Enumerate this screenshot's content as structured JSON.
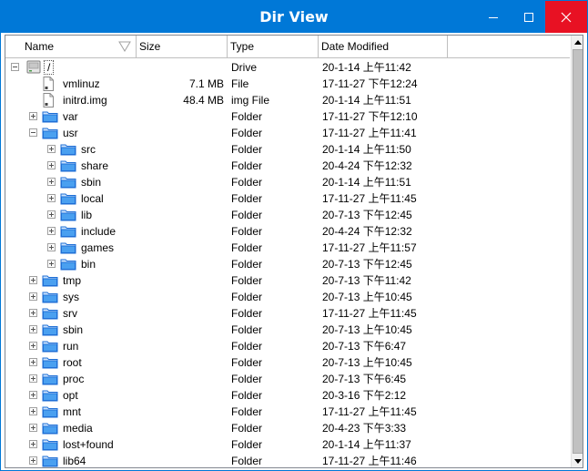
{
  "window": {
    "title": "Dir View"
  },
  "columns": {
    "name": "Name",
    "size": "Size",
    "type": "Type",
    "date": "Date Modified"
  },
  "rows": [
    {
      "name": "/",
      "size": "",
      "type": "Drive",
      "date": "20-1-14 上午11:42",
      "icon": "drive-icon",
      "expander": "minus",
      "depth": 0
    },
    {
      "name": "vmlinuz",
      "size": "7.1 MB",
      "type": "File",
      "date": "17-11-27 下午12:24",
      "icon": "file-icon",
      "expander": "",
      "depth": 1
    },
    {
      "name": "initrd.img",
      "size": "48.4 MB",
      "type": "img File",
      "date": "20-1-14 上午11:51",
      "icon": "file-icon",
      "expander": "",
      "depth": 1
    },
    {
      "name": "var",
      "size": "",
      "type": "Folder",
      "date": "17-11-27 下午12:10",
      "icon": "folder-icon",
      "expander": "plus",
      "depth": 1
    },
    {
      "name": "usr",
      "size": "",
      "type": "Folder",
      "date": "17-11-27 上午11:41",
      "icon": "folder-icon",
      "expander": "minus",
      "depth": 1
    },
    {
      "name": "src",
      "size": "",
      "type": "Folder",
      "date": "20-1-14 上午11:50",
      "icon": "folder-icon",
      "expander": "plus",
      "depth": 2
    },
    {
      "name": "share",
      "size": "",
      "type": "Folder",
      "date": "20-4-24 下午12:32",
      "icon": "folder-icon",
      "expander": "plus",
      "depth": 2
    },
    {
      "name": "sbin",
      "size": "",
      "type": "Folder",
      "date": "20-1-14 上午11:51",
      "icon": "folder-icon",
      "expander": "plus",
      "depth": 2
    },
    {
      "name": "local",
      "size": "",
      "type": "Folder",
      "date": "17-11-27 上午11:45",
      "icon": "folder-icon",
      "expander": "plus",
      "depth": 2
    },
    {
      "name": "lib",
      "size": "",
      "type": "Folder",
      "date": "20-7-13 下午12:45",
      "icon": "folder-icon",
      "expander": "plus",
      "depth": 2
    },
    {
      "name": "include",
      "size": "",
      "type": "Folder",
      "date": "20-4-24 下午12:32",
      "icon": "folder-icon",
      "expander": "plus",
      "depth": 2
    },
    {
      "name": "games",
      "size": "",
      "type": "Folder",
      "date": "17-11-27 上午11:57",
      "icon": "folder-icon",
      "expander": "plus",
      "depth": 2
    },
    {
      "name": "bin",
      "size": "",
      "type": "Folder",
      "date": "20-7-13 下午12:45",
      "icon": "folder-icon",
      "expander": "plus",
      "depth": 2
    },
    {
      "name": "tmp",
      "size": "",
      "type": "Folder",
      "date": "20-7-13 下午11:42",
      "icon": "folder-icon",
      "expander": "plus",
      "depth": 1
    },
    {
      "name": "sys",
      "size": "",
      "type": "Folder",
      "date": "20-7-13 上午10:45",
      "icon": "folder-icon",
      "expander": "plus",
      "depth": 1
    },
    {
      "name": "srv",
      "size": "",
      "type": "Folder",
      "date": "17-11-27 上午11:45",
      "icon": "folder-icon",
      "expander": "plus",
      "depth": 1
    },
    {
      "name": "sbin",
      "size": "",
      "type": "Folder",
      "date": "20-7-13 上午10:45",
      "icon": "folder-icon",
      "expander": "plus",
      "depth": 1
    },
    {
      "name": "run",
      "size": "",
      "type": "Folder",
      "date": "20-7-13 下午6:47",
      "icon": "folder-icon",
      "expander": "plus",
      "depth": 1
    },
    {
      "name": "root",
      "size": "",
      "type": "Folder",
      "date": "20-7-13 上午10:45",
      "icon": "folder-icon",
      "expander": "plus",
      "depth": 1
    },
    {
      "name": "proc",
      "size": "",
      "type": "Folder",
      "date": "20-7-13 下午6:45",
      "icon": "folder-icon",
      "expander": "plus",
      "depth": 1
    },
    {
      "name": "opt",
      "size": "",
      "type": "Folder",
      "date": "20-3-16 下午2:12",
      "icon": "folder-icon",
      "expander": "plus",
      "depth": 1
    },
    {
      "name": "mnt",
      "size": "",
      "type": "Folder",
      "date": "17-11-27 上午11:45",
      "icon": "folder-icon",
      "expander": "plus",
      "depth": 1
    },
    {
      "name": "media",
      "size": "",
      "type": "Folder",
      "date": "20-4-23 下午3:33",
      "icon": "folder-icon",
      "expander": "plus",
      "depth": 1
    },
    {
      "name": "lost+found",
      "size": "",
      "type": "Folder",
      "date": "20-1-14 上午11:37",
      "icon": "folder-icon",
      "expander": "plus",
      "depth": 1
    },
    {
      "name": "lib64",
      "size": "",
      "type": "Folder",
      "date": "17-11-27 上午11:46",
      "icon": "folder-icon",
      "expander": "plus",
      "depth": 1
    }
  ]
}
